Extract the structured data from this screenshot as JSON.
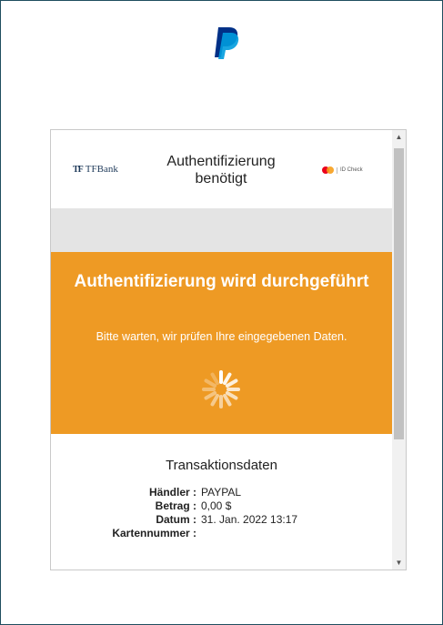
{
  "header": {
    "logo_icon": "paypal-logo-icon"
  },
  "popup": {
    "bank_name": "TFBank",
    "bank_mark": "TF",
    "title": "Authentifizierung benötigt",
    "scheme_label": "ID Check",
    "processing": {
      "title": "Authentifizierung wird durchgeführt",
      "subtitle": "Bitte warten, wir prüfen Ihre eingegebenen Daten.",
      "spinner_icon": "loading-spinner-icon"
    },
    "transaction": {
      "title": "Transaktionsdaten",
      "rows": [
        {
          "label": "Händler :",
          "value": "PAYPAL"
        },
        {
          "label": "Betrag :",
          "value": "0,00 $"
        },
        {
          "label": "Datum :",
          "value": "31. Jan. 2022 13:17"
        },
        {
          "label": "Kartennummer :",
          "value": ""
        }
      ]
    }
  },
  "colors": {
    "accent_orange": "#ee9a24",
    "paypal_dark": "#003087",
    "paypal_light": "#009cde"
  }
}
